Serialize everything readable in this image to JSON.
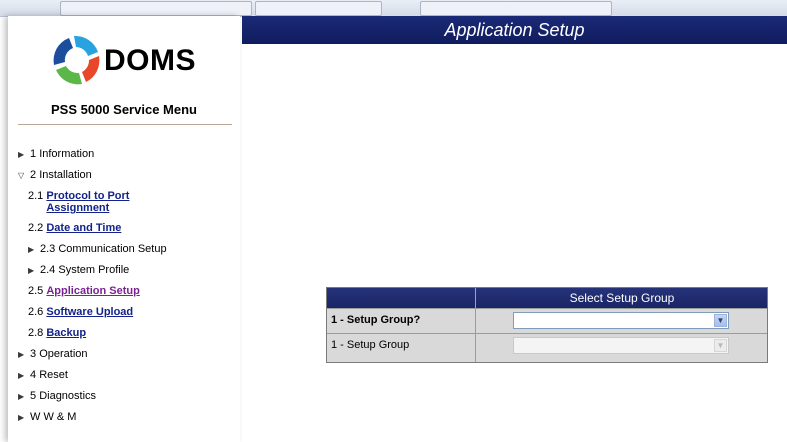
{
  "header": {
    "title": "Application Setup"
  },
  "brand": {
    "logo_text": "DOMS",
    "menu_title": "PSS 5000 Service Menu"
  },
  "nav": [
    {
      "number": "1",
      "label": "Information",
      "type": "collapsed"
    },
    {
      "number": "2",
      "label": "Installation",
      "type": "expanded"
    },
    {
      "number": "2.1",
      "label": "Protocol to Port Assignment",
      "type": "link"
    },
    {
      "number": "2.2",
      "label": "Date and Time",
      "type": "link"
    },
    {
      "number": "2.3",
      "label": "Communication Setup",
      "type": "collapsed"
    },
    {
      "number": "2.4",
      "label": "System Profile",
      "type": "collapsed"
    },
    {
      "number": "2.5",
      "label": "Application Setup",
      "type": "link-active"
    },
    {
      "number": "2.6",
      "label": "Software Upload",
      "type": "link"
    },
    {
      "number": "2.8",
      "label": "Backup",
      "type": "link"
    },
    {
      "number": "3",
      "label": "Operation",
      "type": "collapsed"
    },
    {
      "number": "4",
      "label": "Reset",
      "type": "collapsed"
    },
    {
      "number": "5",
      "label": "Diagnostics",
      "type": "collapsed"
    },
    {
      "number": "",
      "label": "W W & M",
      "type": "collapsed"
    }
  ],
  "form": {
    "header_right": "Select Setup Group",
    "rows": [
      {
        "label": "1 - Setup Group?",
        "value": "",
        "enabled": true
      },
      {
        "label": "1 - Setup Group",
        "value": "",
        "enabled": false
      }
    ]
  },
  "colors": {
    "header_bg": "#1b2a77",
    "link": "#13228a",
    "link_active": "#7a2293"
  }
}
